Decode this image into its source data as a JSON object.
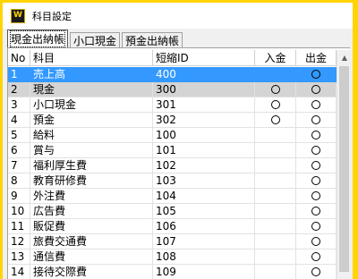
{
  "window": {
    "title": "科目設定",
    "icon_text": "W"
  },
  "tabs": [
    {
      "label": "現金出納帳",
      "active": true
    },
    {
      "label": "小口現金",
      "active": false
    },
    {
      "label": "預金出納帳",
      "active": false
    }
  ],
  "table": {
    "headers": {
      "no": "No",
      "name": "科目",
      "code": "短縮ID",
      "deposit": "入金",
      "withdrawal": "出金"
    },
    "rows": [
      {
        "no": "1",
        "name": "売上高",
        "code": "400",
        "deposit": false,
        "withdrawal": true,
        "state": "selected"
      },
      {
        "no": "2",
        "name": "現金",
        "code": "300",
        "deposit": true,
        "withdrawal": true,
        "state": "gray"
      },
      {
        "no": "3",
        "name": "小口現金",
        "code": "301",
        "deposit": true,
        "withdrawal": true,
        "state": ""
      },
      {
        "no": "4",
        "name": "預金",
        "code": "302",
        "deposit": true,
        "withdrawal": true,
        "state": ""
      },
      {
        "no": "5",
        "name": "給料",
        "code": "100",
        "deposit": false,
        "withdrawal": true,
        "state": ""
      },
      {
        "no": "6",
        "name": "賞与",
        "code": "101",
        "deposit": false,
        "withdrawal": true,
        "state": ""
      },
      {
        "no": "7",
        "name": "福利厚生費",
        "code": "102",
        "deposit": false,
        "withdrawal": true,
        "state": ""
      },
      {
        "no": "8",
        "name": "教育研修費",
        "code": "103",
        "deposit": false,
        "withdrawal": true,
        "state": ""
      },
      {
        "no": "9",
        "name": "外注費",
        "code": "104",
        "deposit": false,
        "withdrawal": true,
        "state": ""
      },
      {
        "no": "10",
        "name": "広告費",
        "code": "105",
        "deposit": false,
        "withdrawal": true,
        "state": ""
      },
      {
        "no": "11",
        "name": "販促費",
        "code": "106",
        "deposit": false,
        "withdrawal": true,
        "state": ""
      },
      {
        "no": "12",
        "name": "旅費交通費",
        "code": "107",
        "deposit": false,
        "withdrawal": true,
        "state": ""
      },
      {
        "no": "13",
        "name": "通信費",
        "code": "108",
        "deposit": false,
        "withdrawal": true,
        "state": ""
      },
      {
        "no": "14",
        "name": "接待交際費",
        "code": "109",
        "deposit": false,
        "withdrawal": true,
        "state": ""
      }
    ]
  },
  "colors": {
    "accent_border": "#ffd400",
    "selection": "#3399ff",
    "row_gray": "#d4d4d4"
  }
}
